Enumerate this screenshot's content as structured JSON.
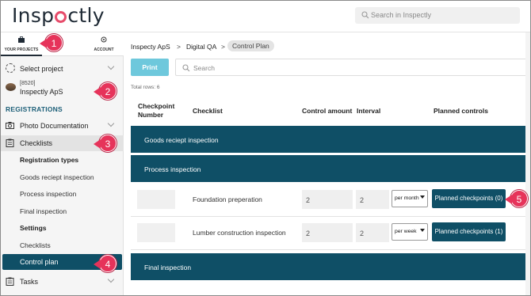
{
  "app": {
    "logo_text_1": "Insp",
    "logo_text_2": "ctly"
  },
  "search": {
    "placeholder": "Search in Inspectly"
  },
  "sidebar": {
    "tabs": [
      {
        "label": "YOUR PROJECTS",
        "icon": "briefcase-icon"
      },
      {
        "label": "ACCOUNT",
        "icon": "gear-icon"
      }
    ],
    "select_project": "Select project",
    "project_number": "[8520]",
    "project_name": "Inspectly ApS",
    "registrations_heading": "REGISTRATIONS",
    "photo_documentation": "Photo Documentation",
    "checklists": "Checklists",
    "registration_types": "Registration types",
    "goods_receipt_inspection": "Goods reciept inspection",
    "process_inspection": "Process inspection",
    "final_inspection": "Final inspection",
    "settings": "Settings",
    "settings_checklists": "Checklists",
    "control_plan": "Control plan",
    "tasks": "Tasks"
  },
  "breadcrumb": {
    "item1": "Inspecty ApS",
    "item2": "Digital QA",
    "item3": "Control Plan",
    "separator": ">"
  },
  "toolbar": {
    "print_label": "Print",
    "search_placeholder": "Search"
  },
  "total_rows": "Total rows: 6",
  "table": {
    "headers": {
      "checkpoint_number_1": "Checkpoint",
      "checkpoint_number_2": "Number",
      "checklist": "Checklist",
      "control_amount": "Control amount",
      "interval": "Interval",
      "planned_controls": "Planned controls"
    },
    "groups": {
      "goods": "Goods reciept inspection",
      "process": "Process inspection",
      "final": "Final inspection"
    },
    "rows": [
      {
        "checklist": "Foundation preperation",
        "amount": "2",
        "interval": "2",
        "period": "per month",
        "button": "Planned checkpoints (0)"
      },
      {
        "checklist": "Lumber construction inspection",
        "amount": "2",
        "interval": "2",
        "period": "per week",
        "button": "Planned checkpoints (1)"
      }
    ]
  },
  "markers": [
    "1",
    "2",
    "3",
    "4",
    "5"
  ],
  "colors": {
    "accent": "#0f4f66",
    "marker": "#e6335a",
    "print": "#6ec8dc",
    "logo_ring": "#e74c6b"
  }
}
